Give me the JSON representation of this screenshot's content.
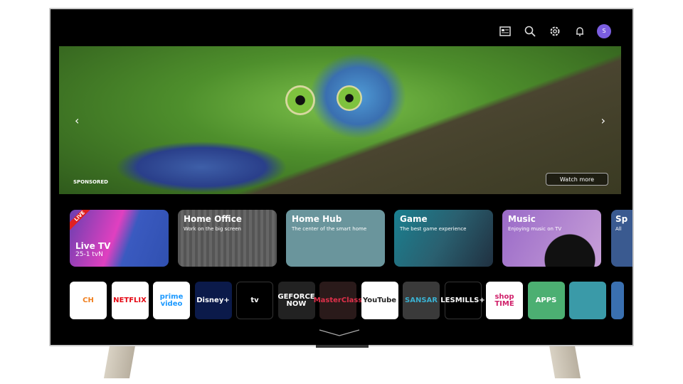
{
  "header": {
    "icons": [
      "guide-icon",
      "search-icon",
      "settings-icon",
      "notification-icon"
    ],
    "avatar_initial": "S",
    "avatar_color": "#7b5ee0"
  },
  "hero": {
    "sponsored_label": "SPONSORED",
    "watch_more_label": "Watch more"
  },
  "cards": [
    {
      "title": "Live TV",
      "subtitle": "25-1  tvN",
      "badge": "LIVE"
    },
    {
      "title": "Home Office",
      "subtitle": "Work on the big screen"
    },
    {
      "title": "Home Hub",
      "subtitle": "The center of the smart home"
    },
    {
      "title": "Game",
      "subtitle": "The best game experience"
    },
    {
      "title": "Music",
      "subtitle": "Enjoying music on TV"
    },
    {
      "title": "Sp",
      "subtitle": "All"
    }
  ],
  "apps": [
    {
      "label": "CH",
      "bg": "#ffffff",
      "fg": "#f08020"
    },
    {
      "label": "NETFLIX",
      "bg": "#ffffff",
      "fg": "#e50914"
    },
    {
      "label": "prime video",
      "bg": "#ffffff",
      "fg": "#1a98ff"
    },
    {
      "label": "Disney+",
      "bg": "#0b1a4a",
      "fg": "#ffffff"
    },
    {
      "label": "tv",
      "bg": "#000000",
      "fg": "#ffffff"
    },
    {
      "label": "GEFORCE NOW",
      "bg": "#222222",
      "fg": "#ffffff"
    },
    {
      "label": "MasterClass",
      "bg": "#2a1a1a",
      "fg": "#e0304a"
    },
    {
      "label": "YouTube",
      "bg": "#ffffff",
      "fg": "#222222"
    },
    {
      "label": "SANSAR",
      "bg": "#3a3a3a",
      "fg": "#3ab0d0"
    },
    {
      "label": "LESMILLS+",
      "bg": "#000000",
      "fg": "#ffffff"
    },
    {
      "label": "shop TIME",
      "bg": "#ffffff",
      "fg": "#d0206a"
    },
    {
      "label": "APPS",
      "bg": "#4caf72",
      "fg": "#ffffff"
    },
    {
      "label": "",
      "bg": "#3a9aa8",
      "fg": "#ffffff"
    },
    {
      "label": "",
      "bg": "#3a70b0",
      "fg": "#ffffff"
    }
  ]
}
